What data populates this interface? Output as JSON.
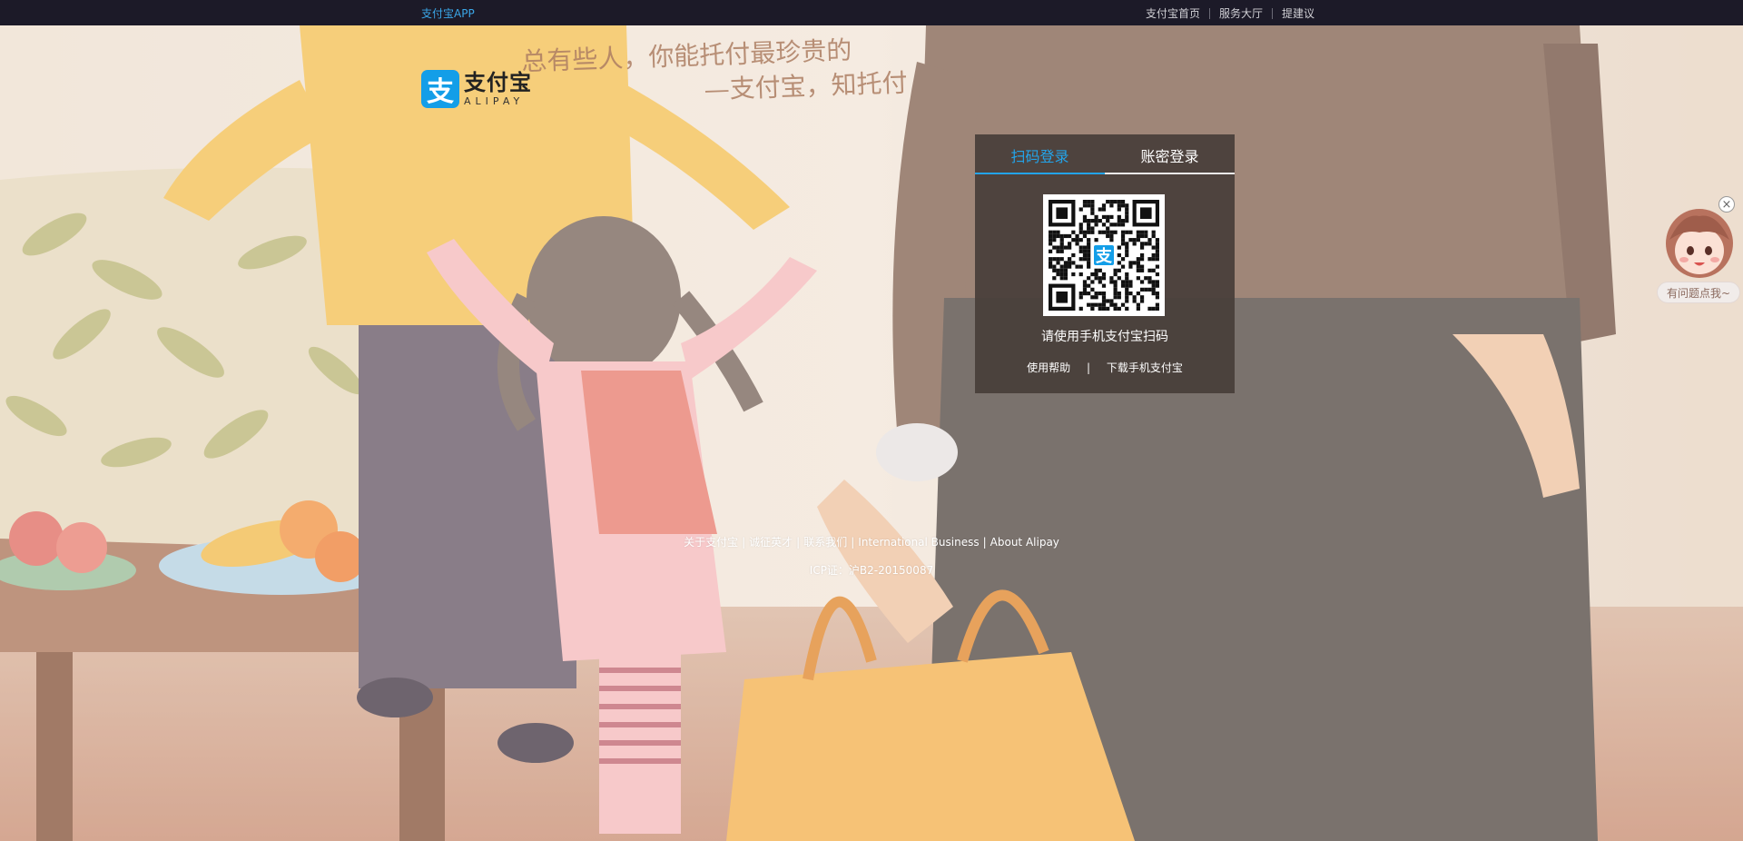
{
  "topbar": {
    "app_link": "支付宝APP",
    "nav": [
      "支付宝首页",
      "服务大厅",
      "提建议"
    ]
  },
  "logo": {
    "mark": "支",
    "cn": "支付宝",
    "en": "ALIPAY"
  },
  "slogan": {
    "line1": "总有些人，你能托付最珍贵的",
    "line2": "—支付宝，知托付"
  },
  "login": {
    "tabs": [
      "扫码登录",
      "账密登录"
    ],
    "active_tab": 0,
    "qr_center": "支",
    "hint": "请使用手机支付宝扫码",
    "links": [
      "使用帮助",
      "下载手机支付宝"
    ],
    "links_separator": "|"
  },
  "footer": {
    "links": [
      "关于支付宝",
      "诚征英才",
      "联系我们",
      "International Business",
      "About Alipay"
    ],
    "icp": "ICP证：沪B2-20150087"
  },
  "help": {
    "close": "×",
    "bubble": "有问题点我~"
  },
  "colors": {
    "accent": "#23a4ea",
    "brand": "#139ee8",
    "topbar": "#1c1a28"
  }
}
